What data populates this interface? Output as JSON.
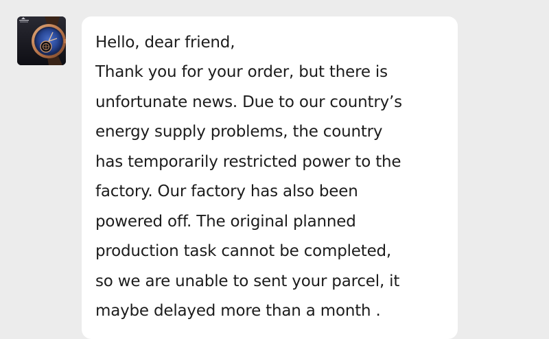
{
  "avatar": {
    "icon": "watch-logo-icon",
    "brand_text": "PAGANI DESIGN"
  },
  "message": {
    "lines": [
      "Hello, dear friend,",
      "Thank you for your order, but there is",
      "unfortunate news. Due to our country’s",
      "energy supply problems, the country",
      "has temporarily restricted power to the",
      "factory. Our factory has also been",
      "powered off. The original planned",
      "production task cannot be completed,",
      "so we are unable to sent your parcel,  it",
      "maybe delayed more than a month ."
    ]
  },
  "colors": {
    "background": "#ececec",
    "bubble": "#ffffff",
    "text": "#1c1c1c"
  }
}
